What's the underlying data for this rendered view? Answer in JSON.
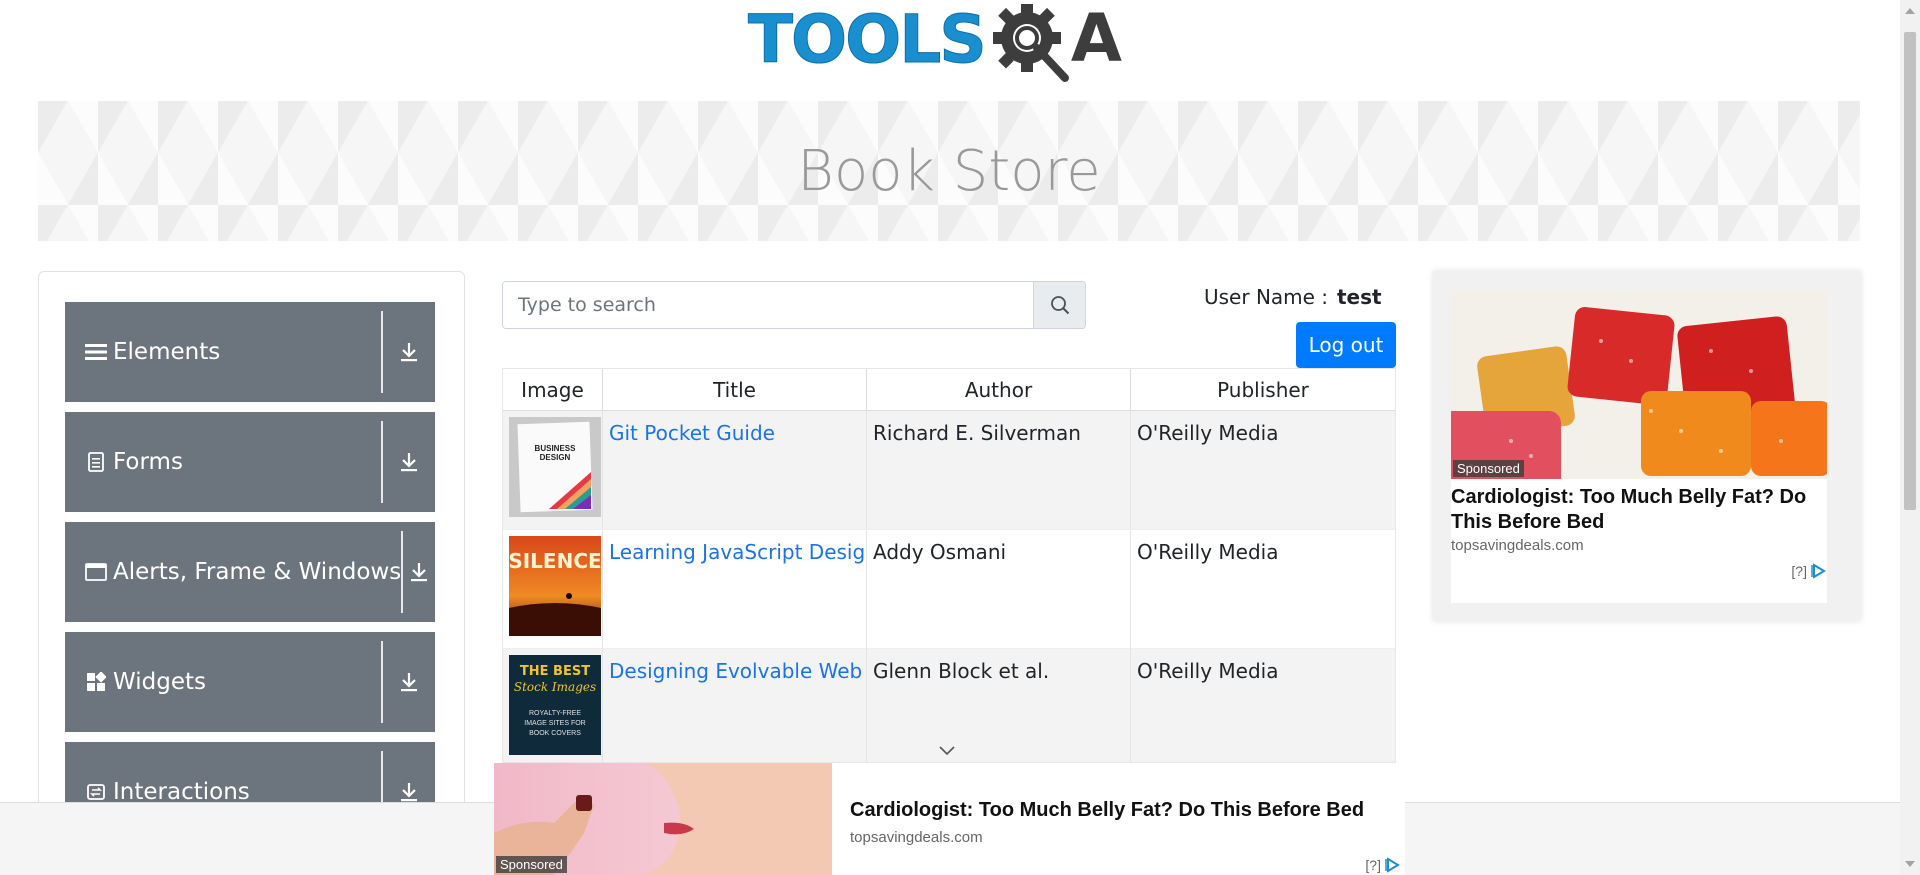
{
  "logo": {
    "text": "TOOLS",
    "suffix": "A",
    "alt": "ToolsQA"
  },
  "banner": {
    "title": "Book Store"
  },
  "nav": {
    "groups": [
      {
        "label": "Elements",
        "icon": "hamburger-icon"
      },
      {
        "label": "Forms",
        "icon": "document-icon"
      },
      {
        "label": "Alerts, Frame & Windows",
        "icon": "window-icon"
      },
      {
        "label": "Widgets",
        "icon": "widgets-icon"
      },
      {
        "label": "Interactions",
        "icon": "interactions-icon"
      }
    ]
  },
  "search": {
    "placeholder": "Type to search",
    "value": ""
  },
  "user": {
    "label": "User Name :",
    "name": "test",
    "logout": "Log out"
  },
  "table": {
    "headers": [
      "Image",
      "Title",
      "Author",
      "Publisher"
    ],
    "rows": [
      {
        "title": "Git Pocket Guide",
        "author": "Richard E. Silverman",
        "publisher": "O'Reilly Media",
        "cover": "business-design-cover"
      },
      {
        "title": "Learning JavaScript Design Patterns",
        "author": "Addy Osmani",
        "publisher": "O'Reilly Media",
        "cover": "silence-cover"
      },
      {
        "title": "Designing Evolvable Web APIs with ASP.NET",
        "author": "Glenn Block et al.",
        "publisher": "O'Reilly Media",
        "cover": "best-stock-images-cover"
      }
    ]
  },
  "sideAd": {
    "sponsored": "Sponsored",
    "title": "Cardiologist: Too Much Belly Fat? Do This Before Bed",
    "source": "topsavingdeals.com",
    "info": "[?]"
  },
  "bottomAd": {
    "sponsored": "Sponsored",
    "title": "Cardiologist: Too Much Belly Fat? Do This Before Bed",
    "source": "topsavingdeals.com",
    "info": "[?]"
  },
  "colors": {
    "brandBlue": "#1a8fd0",
    "navGray": "#6c757d",
    "primary": "#007bff",
    "link": "#1a73e8"
  }
}
